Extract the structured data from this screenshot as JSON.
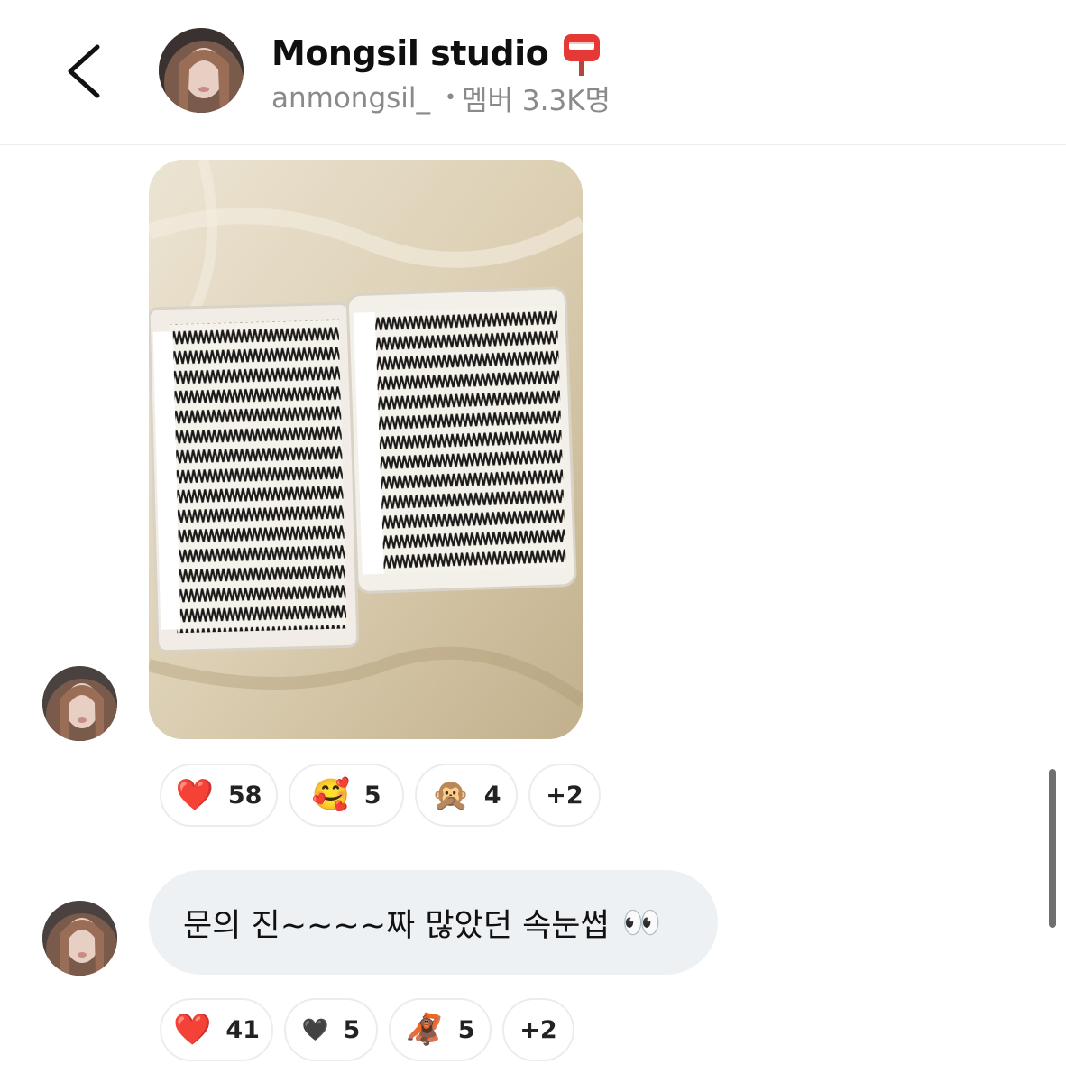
{
  "header": {
    "back_icon": "chevron-left-icon",
    "title": "Mongsil studio",
    "title_icon": "postbox-icon",
    "handle": "anmongsil_",
    "separator": "•",
    "members": "멤버 3.3K명"
  },
  "messages": [
    {
      "type": "image",
      "image_description": "eyelash-case-photo",
      "reactions": [
        {
          "emoji": "❤️",
          "count": "58"
        },
        {
          "emoji": "🥰",
          "count": "5"
        },
        {
          "emoji": "🙊",
          "count": "4"
        },
        {
          "emoji": "",
          "count": "+2"
        }
      ]
    },
    {
      "type": "text",
      "text": "문의 진~~~~짜 많았던 속눈썹",
      "trailing_emoji": "👀",
      "reactions": [
        {
          "emoji": "❤️",
          "count": "41"
        },
        {
          "emoji": "🖤",
          "count": "5"
        },
        {
          "emoji": "🦧",
          "count": "5"
        },
        {
          "emoji": "",
          "count": "+2"
        }
      ]
    }
  ],
  "colors": {
    "bubble_bg": "#eef1f3",
    "pill_border": "#ececec",
    "subtitle": "#8a8a8a"
  }
}
